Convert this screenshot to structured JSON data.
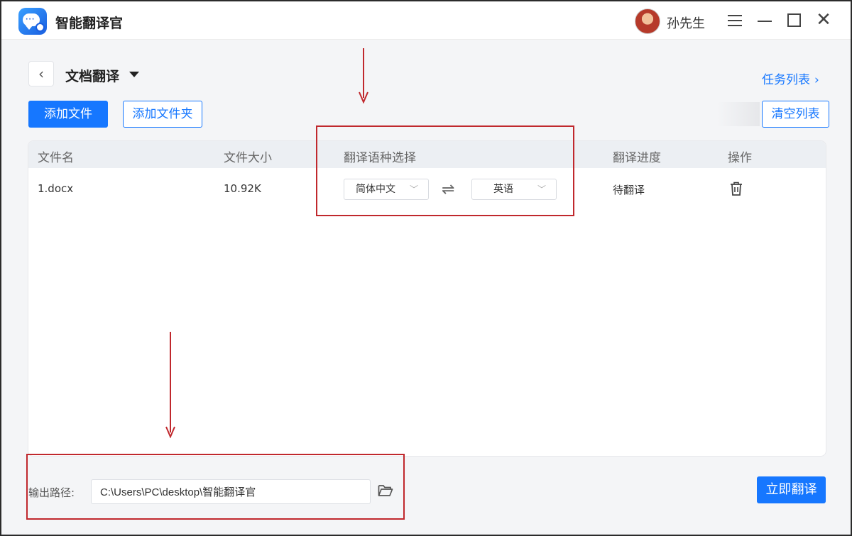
{
  "app": {
    "title": "智能翻译官",
    "user_name": "孙先生"
  },
  "header": {
    "page_title": "文档翻译",
    "task_list_link": "任务列表",
    "task_list_chevron": "›"
  },
  "toolbar": {
    "add_file": "添加文件",
    "add_folder": "添加文件夹",
    "clear_list": "清空列表"
  },
  "table": {
    "columns": {
      "filename": "文件名",
      "filesize": "文件大小",
      "language": "翻译语种选择",
      "progress": "翻译进度",
      "actions": "操作"
    },
    "rows": [
      {
        "filename": "1.docx",
        "filesize": "10.92K",
        "source_language": "简体中文",
        "target_language": "英语",
        "progress": "待翻译"
      }
    ]
  },
  "footer": {
    "output_label": "输出路径:",
    "output_path": "C:\\Users\\PC\\desktop\\智能翻译官",
    "translate_button": "立即翻译"
  },
  "colors": {
    "primary": "#1677ff",
    "annotation": "#c0282d"
  },
  "icons": {
    "back": "chevron-left-icon",
    "swap": "swap-arrows-icon",
    "delete": "trash-icon",
    "folder": "folder-open-icon"
  }
}
